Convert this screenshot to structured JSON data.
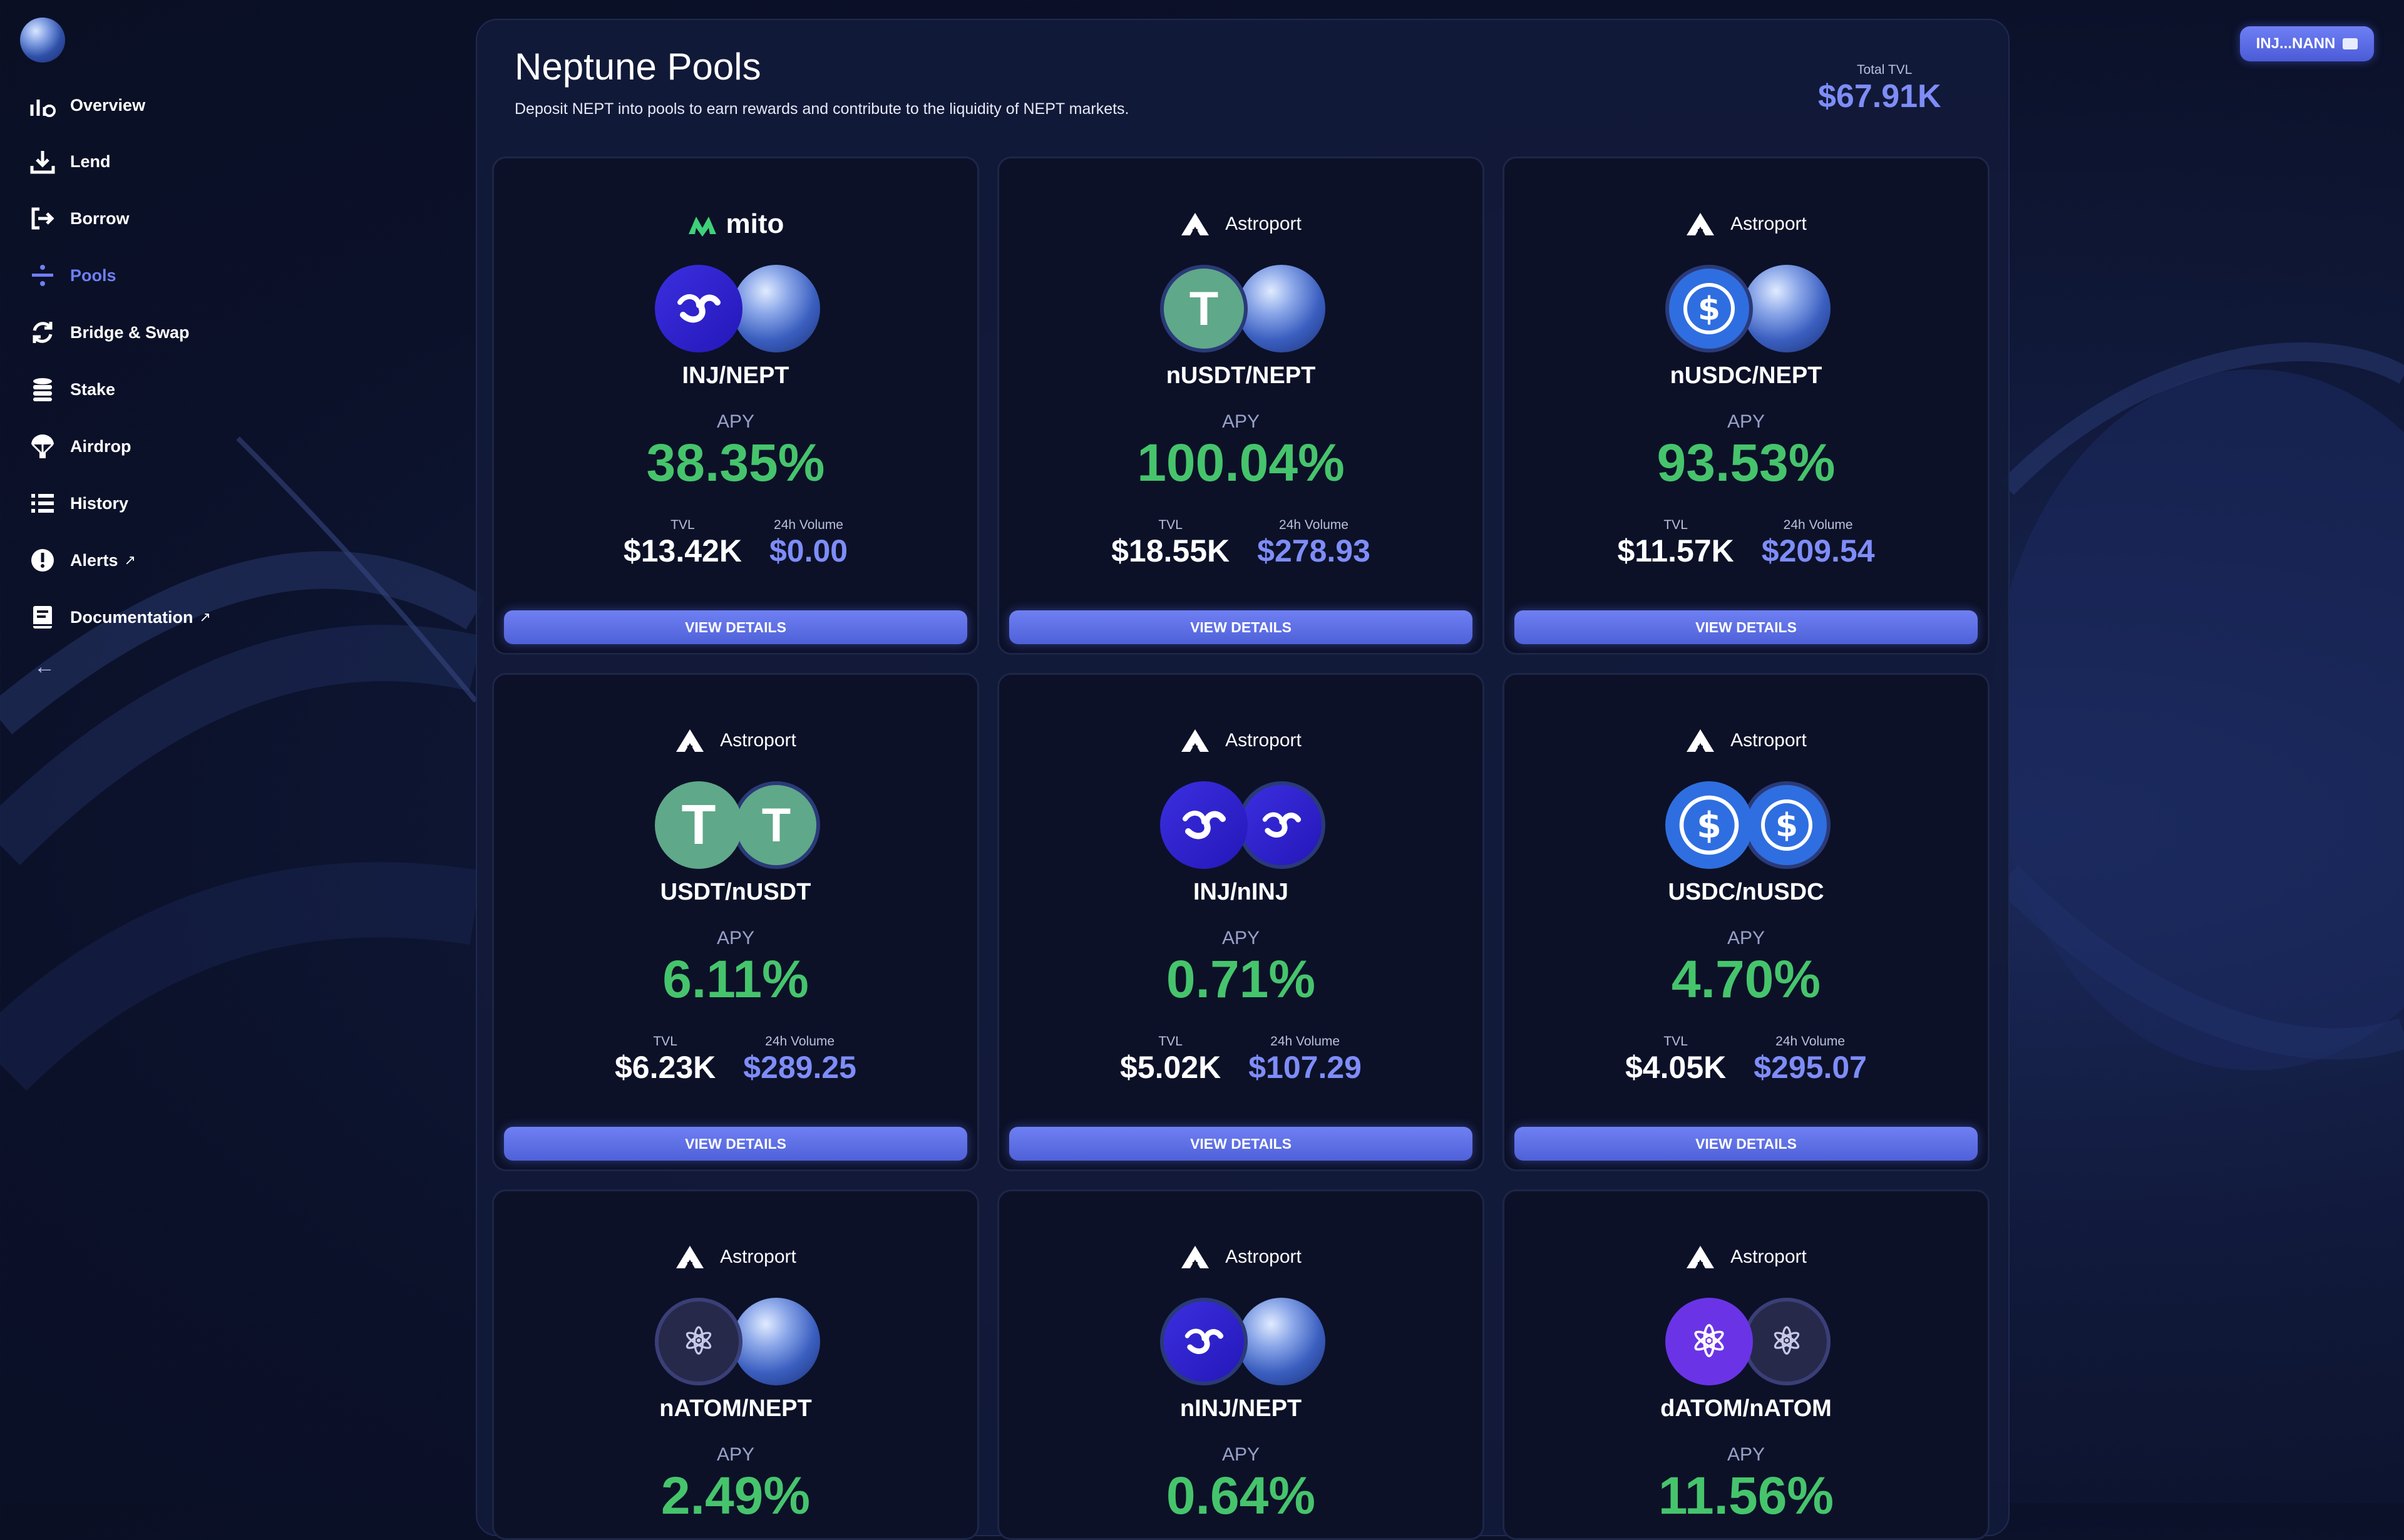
{
  "sidebar": {
    "items": [
      {
        "label": "Overview",
        "icon": "chart-dashboard-icon"
      },
      {
        "label": "Lend",
        "icon": "download-icon"
      },
      {
        "label": "Borrow",
        "icon": "sign-out-icon"
      },
      {
        "label": "Pools",
        "icon": "divide-icon",
        "active": true
      },
      {
        "label": "Bridge & Swap",
        "icon": "refresh-icon"
      },
      {
        "label": "Stake",
        "icon": "coins-icon"
      },
      {
        "label": "Airdrop",
        "icon": "parachute-icon"
      },
      {
        "label": "History",
        "icon": "list-icon"
      },
      {
        "label": "Alerts",
        "icon": "alert-icon",
        "external": true
      },
      {
        "label": "Documentation",
        "icon": "book-icon",
        "external": true
      }
    ],
    "collapse_icon": "arrow-left-icon",
    "ext_glyph": "↗",
    "collapse_glyph": "←"
  },
  "wallet": {
    "label": "INJ...NANN"
  },
  "header": {
    "title": "Neptune Pools",
    "subtitle": "Deposit NEPT into pools to earn rewards and contribute to the liquidity of NEPT markets.",
    "total_tvl_label": "Total TVL",
    "total_tvl_value": "$67.91K"
  },
  "pools": [
    {
      "provider": "mito",
      "pair": "INJ/NEPT",
      "apy_label": "APY",
      "apy": "38.35%",
      "tvl_label": "TVL",
      "tvl": "$13.42K",
      "volume_label": "24h Volume",
      "volume": "$0.00",
      "button": "VIEW DETAILS"
    },
    {
      "provider": "Astroport",
      "pair": "nUSDT/NEPT",
      "apy_label": "APY",
      "apy": "100.04%",
      "tvl_label": "TVL",
      "tvl": "$18.55K",
      "volume_label": "24h Volume",
      "volume": "$278.93",
      "button": "VIEW DETAILS"
    },
    {
      "provider": "Astroport",
      "pair": "nUSDC/NEPT",
      "apy_label": "APY",
      "apy": "93.53%",
      "tvl_label": "TVL",
      "tvl": "$11.57K",
      "volume_label": "24h Volume",
      "volume": "$209.54",
      "button": "VIEW DETAILS"
    },
    {
      "provider": "Astroport",
      "pair": "USDT/nUSDT",
      "apy_label": "APY",
      "apy": "6.11%",
      "tvl_label": "TVL",
      "tvl": "$6.23K",
      "volume_label": "24h Volume",
      "volume": "$289.25",
      "button": "VIEW DETAILS"
    },
    {
      "provider": "Astroport",
      "pair": "INJ/nINJ",
      "apy_label": "APY",
      "apy": "0.71%",
      "tvl_label": "TVL",
      "tvl": "$5.02K",
      "volume_label": "24h Volume",
      "volume": "$107.29",
      "button": "VIEW DETAILS"
    },
    {
      "provider": "Astroport",
      "pair": "USDC/nUSDC",
      "apy_label": "APY",
      "apy": "4.70%",
      "tvl_label": "TVL",
      "tvl": "$4.05K",
      "volume_label": "24h Volume",
      "volume": "$295.07",
      "button": "VIEW DETAILS"
    },
    {
      "provider": "Astroport",
      "pair": "nATOM/NEPT",
      "apy_label": "APY",
      "apy": "2.49%"
    },
    {
      "provider": "Astroport",
      "pair": "nINJ/NEPT",
      "apy_label": "APY",
      "apy": "0.64%"
    },
    {
      "provider": "Astroport",
      "pair": "dATOM/nATOM",
      "apy_label": "APY",
      "apy": "11.56%"
    }
  ],
  "token_glyphs": {
    "usdt": "T",
    "usdc": "$",
    "atom": "⚛"
  },
  "colors": {
    "accent": "#6f7ff5",
    "apy_green": "#46c46c",
    "volume_blue": "#7e8df7"
  }
}
